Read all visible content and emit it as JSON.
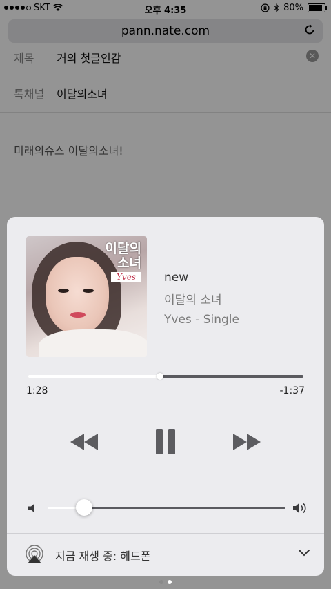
{
  "status_bar": {
    "carrier": "SKT",
    "time": "오후 4:35",
    "battery_percent": "80%",
    "battery_level": 0.8
  },
  "browser": {
    "url": "pann.nate.com"
  },
  "form": {
    "rows": [
      {
        "label": "제목",
        "value": "거의 첫글인감"
      },
      {
        "label": "톡채널",
        "value": "이달의소녀"
      }
    ],
    "body_text": "미래의슈스 이달의소녀!"
  },
  "now_playing": {
    "album_art_title": "이달의\n소녀",
    "album_art_signature": "Yves",
    "track_title": "new",
    "artist": "이달의 소녀",
    "album": "Yves - Single",
    "elapsed": "1:28",
    "remaining": "-1:37",
    "progress": 0.48,
    "volume": 0.15,
    "output_label": "지금 재생 중: 헤드폰"
  },
  "colors": {
    "card_background": "#ececef",
    "track_played": "#ffffff",
    "track_unplayed": "#5a5a5f"
  },
  "pages": {
    "count": 2,
    "active": 1
  }
}
